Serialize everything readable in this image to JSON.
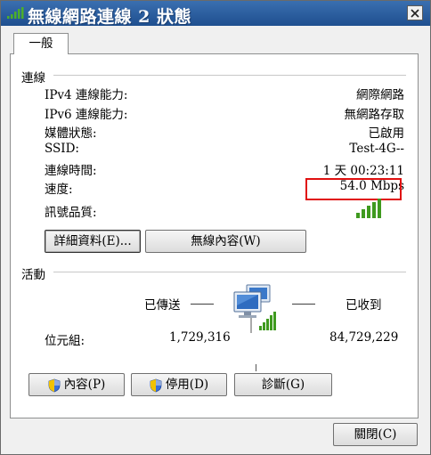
{
  "window": {
    "title": "無線網路連線 2 狀態",
    "close_glyph": "✕"
  },
  "tabs": [
    {
      "label": "一般"
    }
  ],
  "connection": {
    "section_label": "連線",
    "rows": [
      {
        "label": "IPv4 連線能力:",
        "value": "網際網路"
      },
      {
        "label": "IPv6 連線能力:",
        "value": "無網路存取"
      },
      {
        "label": "媒體狀態:",
        "value": "已啟用"
      },
      {
        "label": "SSID:",
        "value": "Test-4G--"
      },
      {
        "label": "連線時間:",
        "value": "1 天 00:23:11"
      },
      {
        "label": "速度:",
        "value": "54.0 Mbps"
      }
    ],
    "signal_label": "訊號品質:",
    "signal_bars": 5,
    "signal_max": 5,
    "highlight_color": "#e01010"
  },
  "buttons": {
    "details": "詳細資料(E)...",
    "wireless_props": "無線內容(W)",
    "properties": "內容(P)",
    "disable": "停用(D)",
    "diagnose": "診斷(G)",
    "close": "關閉(C)"
  },
  "activity": {
    "section_label": "活動",
    "sent_label": "已傳送",
    "received_label": "已收到",
    "bytes_label": "位元組:",
    "bytes_sent": "1,729,316",
    "bytes_received": "84,729,229"
  },
  "icons": {
    "title": "wifi-signal-icon",
    "signal": "signal-bars-icon",
    "network": "network-computers-icon",
    "shield": "uac-shield-icon"
  }
}
